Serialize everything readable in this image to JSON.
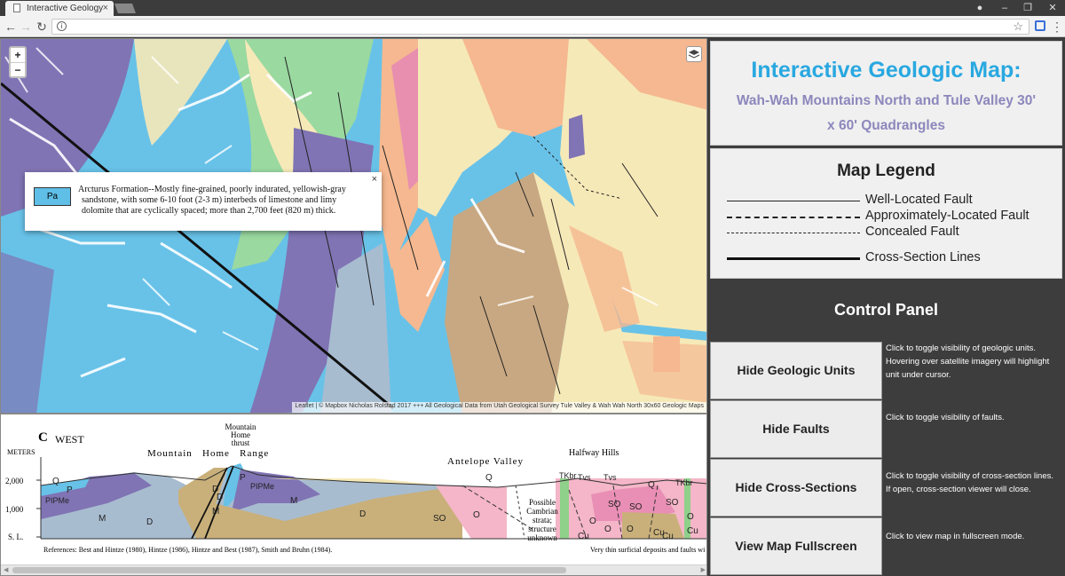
{
  "browser": {
    "tab_title": "Interactive Geology",
    "tab_close": "×",
    "url": ""
  },
  "map": {
    "zoom_in": "+",
    "zoom_out": "−",
    "popup": {
      "unit_code": "Pa",
      "description": "Arcturus Formation--Mostly fine-grained, poorly indurated, yellowish-gray sandstone, with some 6-10 foot (2-3 m) interbeds of limestone and limy dolomite that are cyclically spaced; more than 2,700 feet (820 m) thick.",
      "close": "×"
    },
    "attribution": "Leaflet | © Mapbox Nicholas Rolstad 2017 +++ All Geological Data from Utah Geological Survey Tule Valley & Wah Wah North 30x60 Geologic Maps"
  },
  "cross_section": {
    "label_letter": "C",
    "label_dir": "WEST",
    "meters": "METERS",
    "ticks": [
      "2,000",
      "1,000",
      "S. L."
    ],
    "place_labels": {
      "mountain_home_thrust": [
        "Mountain",
        "Home",
        "thrust"
      ],
      "mountain_home_range": "Mountain   Home   Range",
      "antelope_valley": "Antelope Valley",
      "halfway_hills": "Halfway Hills",
      "possible_cambrian": [
        "Possible",
        "Cambrian",
        "strata;",
        "structure",
        "unknown"
      ]
    },
    "unit_labels": [
      "Q",
      "P",
      "PIPMe",
      "M",
      "D",
      "M",
      "D",
      "D",
      "P",
      "PIPMe",
      "M",
      "D",
      "Q",
      "SO",
      "O",
      "TKbr",
      "Tvs",
      "Tvs",
      "SO",
      "O",
      "SO",
      "O",
      "Q",
      "TKbr",
      "SO",
      "O",
      "Cu",
      "Cu",
      "Cu",
      "Cu",
      "O"
    ],
    "references": "References:  Best and Hintze (1980), Hintze (1986), Hintze and Best (1987), Smith and Bruhn (1984).",
    "note": "Very thin surficial deposits and faults wi"
  },
  "panel": {
    "title": "Interactive Geologic Map:",
    "subtitle": "Wah-Wah Mountains North and Tule Valley 30' x 60' Quadrangles",
    "legend_title": "Map Legend",
    "legend": [
      {
        "label": "Well-Located Fault"
      },
      {
        "label": "Approximately-Located Fault"
      },
      {
        "label": "Concealed Fault"
      },
      {
        "label": "Cross-Section Lines"
      }
    ],
    "control_title": "Control Panel",
    "controls": [
      {
        "label": "Hide Geologic Units",
        "desc": "Click to toggle visibility of geologic units. Hovering over satellite imagery will highlight unit under cursor."
      },
      {
        "label": "Hide Faults",
        "desc": "Click to toggle visibility of faults."
      },
      {
        "label": "Hide Cross-Sections",
        "desc": "Click to toggle visibility of cross-section lines. If open, cross-section viewer will close."
      },
      {
        "label": "View Map Fullscreen",
        "desc": "Click to view map in fullscreen mode."
      }
    ]
  },
  "colors": {
    "title_blue": "#29a8e0",
    "subtitle_purple": "#8c87bc",
    "unit_sky": "#68c2e8",
    "unit_purple": "#8074b4",
    "unit_tan": "#c8a882",
    "unit_peach": "#f5b890",
    "unit_pink": "#f4b6c8",
    "unit_olive": "#c9b07a",
    "unit_grayblue": "#a8bcd0",
    "unit_cream": "#f6e9b8"
  }
}
